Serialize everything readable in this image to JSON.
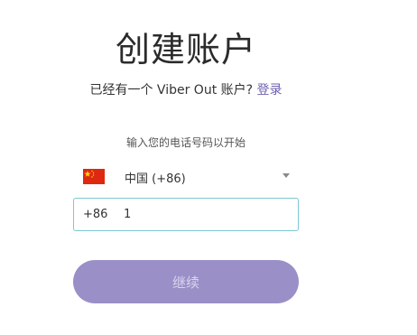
{
  "header": {
    "title": "创建账户"
  },
  "login_prompt": {
    "text": "已经有一个 Viber Out 账户?",
    "link_label": "登录"
  },
  "form": {
    "hint": "输入您的电话号码以开始",
    "country": {
      "flag_icon": "china-flag-icon",
      "selected": "中国 (+86)"
    },
    "phone": {
      "dial_code": "+86",
      "value": "1"
    },
    "continue_label": "继续"
  },
  "colors": {
    "accent": "#6b60b0",
    "button_bg": "#9b8fc7",
    "button_text": "#d9d3ef",
    "input_border": "#7fc7d2",
    "flag_red": "#de2910",
    "flag_yellow": "#ffde00"
  }
}
